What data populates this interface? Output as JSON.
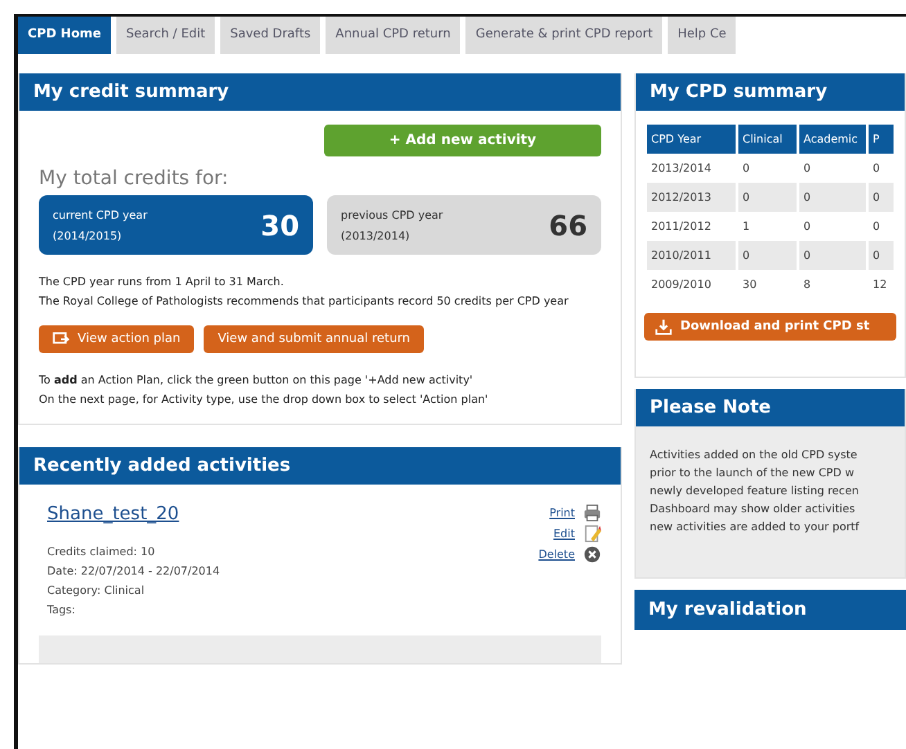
{
  "tabs": [
    {
      "label": "CPD Home",
      "selected": true
    },
    {
      "label": "Search / Edit",
      "selected": false
    },
    {
      "label": "Saved Drafts",
      "selected": false
    },
    {
      "label": "Annual CPD return",
      "selected": false
    },
    {
      "label": "Generate & print CPD report",
      "selected": false
    },
    {
      "label": "Help Ce",
      "selected": false
    }
  ],
  "credit_summary": {
    "title": "My credit summary",
    "add_button": "+ Add new activity",
    "totals_label": "My total credits for:",
    "totals": [
      {
        "label": "current CPD year",
        "period": "(2014/2015)",
        "value": "30",
        "selected": true
      },
      {
        "label": "previous CPD year",
        "period": "(2013/2014)",
        "value": "66",
        "selected": false
      }
    ],
    "info": [
      "The CPD year runs from 1 April to 31 March.",
      "The Royal College of Pathologists recommends that participants record 50 credits per CPD year"
    ],
    "buttons": [
      {
        "label": "View action plan",
        "icon": true
      },
      {
        "label": "View and submit annual return",
        "icon": false
      }
    ],
    "instructions": [
      "To **add** an Action Plan, click the green button on this page '+Add new activity'",
      "On the next page, for Activity type, use the drop down box to select 'Action plan'"
    ]
  },
  "cpd_summary": {
    "title": "My CPD summary",
    "columns": [
      "CPD Year",
      "Clinical",
      "Academic",
      "P"
    ],
    "rows": [
      [
        "2013/2014",
        "0",
        "0",
        "0"
      ],
      [
        "2012/2013",
        "0",
        "0",
        "0"
      ],
      [
        "2011/2012",
        "1",
        "0",
        "0"
      ],
      [
        "2010/2011",
        "0",
        "0",
        "0"
      ],
      [
        "2009/2010",
        "30",
        "8",
        "12"
      ]
    ],
    "download_button": "Download and print CPD st"
  },
  "recent": {
    "title": "Recently added activities",
    "activities": [
      {
        "title": "Shane_test_20",
        "actions": [
          {
            "label": "Print",
            "kind": "print"
          },
          {
            "label": "Edit",
            "kind": "edit"
          },
          {
            "label": "Delete",
            "kind": "delete"
          }
        ],
        "details": [
          "Credits claimed: 10",
          "Date: 22/07/2014 - 22/07/2014",
          "Category: Clinical",
          "Tags:"
        ]
      }
    ]
  },
  "note": {
    "title": "Please Note",
    "lines": [
      "Activities added on the old CPD syste",
      "prior to the launch of the new CPD w",
      "newly developed feature listing recen",
      "Dashboard may show older activities",
      "new activities are added to your portf"
    ]
  },
  "revalidation": {
    "title": "My revalidation"
  }
}
